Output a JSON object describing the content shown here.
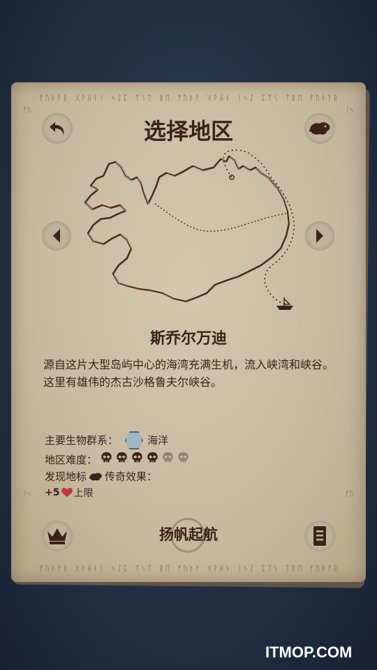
{
  "screen": {
    "title": "选择地区",
    "region_name": "斯乔尔万迪",
    "description": "源自这片大型岛屿中心的海湾充满生机，流入峡湾和峡谷。这里有雄伟的杰古沙格鲁夫尔峡谷。",
    "biome_label": "主要生物群系：",
    "biome_value": "海洋",
    "biome_icon": "water-waves-icon",
    "difficulty_label": "地区难度：",
    "difficulty": {
      "filled": 4,
      "total": 6
    },
    "landmark_label_prefix": "发现地标",
    "landmark_label_suffix": "传奇效果：",
    "landmark_icon": "landmark-creature-icon",
    "bonus_value": "+5",
    "bonus_icon": "heart-icon",
    "bonus_text": "上限",
    "sail_label": "扬帆起航"
  },
  "runes": {
    "top": "ᚠᚢᚦᚨᚱ ᚷᚹᚺᚾᛁ ᛃᛇᛈ ᛉᛊᛏ ᛒᛖ ᚠᚢᚦᚨ ᚷᚹᚺᚾ ᛁᛃᛇ ᛈᛉᛊ ᛏᛒᛖ ᚠᚢᚦᚨᚱ",
    "bottom": "ᚠᚢᚦᚨᚱ ᚷᚹᚺᚾᛁ ᛃᛇᛈ ᛉᛊᛏ ᛒᛖ ᚠᚢᚦᚨ ᚷᚹᚺᚾ ᛁᛃᛇ ᛈᛉᛊ ᛏᛒᛖ ᚠᚢᚦᚨᚱ",
    "left": "ᚠᚢᚦᚨᚱᚷ",
    "right": "ᛁᛃᛇᛈᛉᛊ"
  },
  "colors": {
    "ink": "#3b2319",
    "parchment": "#c8baa0",
    "heart": "#c0393b",
    "background": "#233044"
  },
  "watermark": "ITMOP.COM"
}
